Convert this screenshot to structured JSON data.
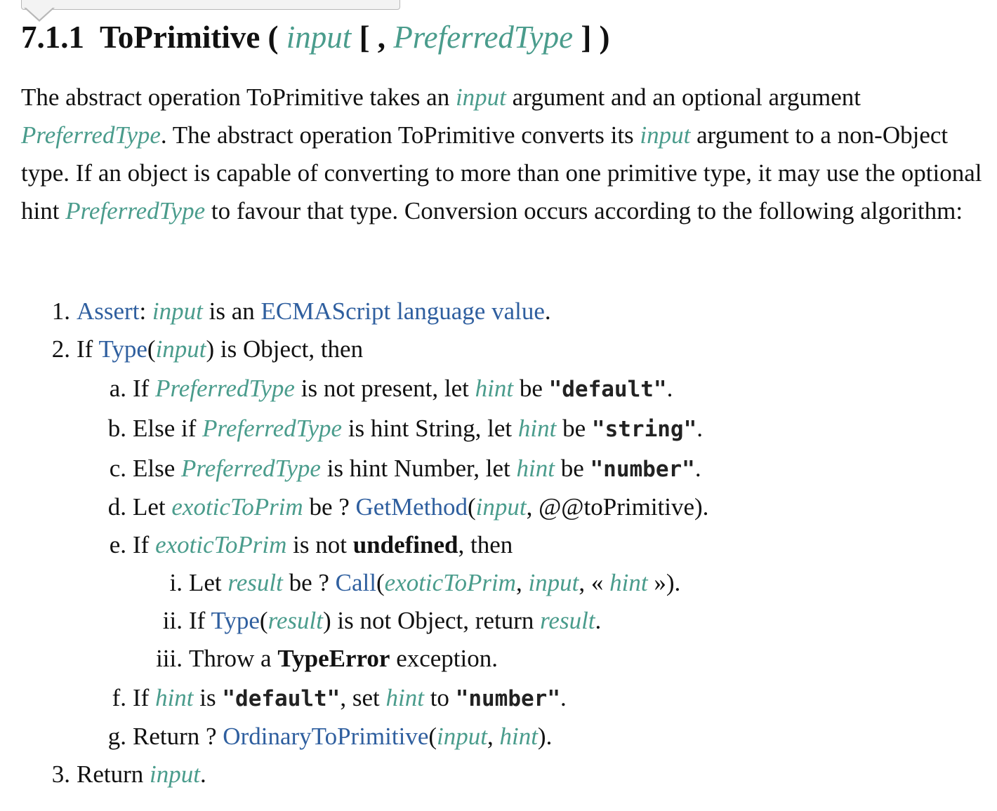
{
  "heading": {
    "secnum": "7.1.1",
    "name": "ToPrimitive",
    "open": "(",
    "param1": "input",
    "bracket_open": "[ ,",
    "param2": "PreferredType",
    "close": "] )"
  },
  "intro": {
    "t1": "The abstract operation ToPrimitive takes an ",
    "v1": "input",
    "t2": " argument and an optional argument ",
    "v2": "PreferredType",
    "t3": ". The abstract operation ToPrimitive converts its ",
    "v3": "input",
    "t4": " argument to a non-Object type. If an object is capable of converting to more than one primitive type, it may use the optional hint ",
    "v4": "PreferredType",
    "t5": " to favour that type. Conversion occurs according to the following algorithm:"
  },
  "steps": {
    "s1": {
      "num": "1.",
      "link1": "Assert",
      "t1": ": ",
      "v1": "input",
      "t2": " is an ",
      "link2": "ECMAScript language value",
      "t3": "."
    },
    "s2": {
      "num": "2.",
      "t1": "If ",
      "link1": "Type",
      "t2": "(",
      "v1": "input",
      "t3": ") is Object, then"
    },
    "sa": {
      "num": "a.",
      "t1": "If ",
      "v1": "PreferredType",
      "t2": " is not present, let ",
      "v2": "hint",
      "t3": " be ",
      "c1": "\"default\"",
      "t4": "."
    },
    "sb": {
      "num": "b.",
      "t1": "Else if ",
      "v1": "PreferredType",
      "t2": " is hint String, let ",
      "v2": "hint",
      "t3": " be ",
      "c1": "\"string\"",
      "t4": "."
    },
    "sc": {
      "num": "c.",
      "t1": "Else ",
      "v1": "PreferredType",
      "t2": " is hint Number, let ",
      "v2": "hint",
      "t3": " be ",
      "c1": "\"number\"",
      "t4": "."
    },
    "sd": {
      "num": "d.",
      "t1": "Let ",
      "v1": "exoticToPrim",
      "t2": " be ? ",
      "link1": "GetMethod",
      "t3": "(",
      "v2": "input",
      "t4": ", @@toPrimitive)."
    },
    "se": {
      "num": "e.",
      "t1": "If ",
      "v1": "exoticToPrim",
      "t2": " is not ",
      "b1": "undefined",
      "t3": ", then"
    },
    "si": {
      "num": "i.",
      "t1": "Let ",
      "v1": "result",
      "t2": " be ? ",
      "link1": "Call",
      "t3": "(",
      "v2": "exoticToPrim",
      "t4": ", ",
      "v3": "input",
      "t5": ", « ",
      "v4": "hint",
      "t6": " »)."
    },
    "sii": {
      "num": "ii.",
      "t1": "If ",
      "link1": "Type",
      "t2": "(",
      "v1": "result",
      "t3": ") is not Object, return ",
      "v2": "result",
      "t4": "."
    },
    "siii": {
      "num": "iii.",
      "t1": "Throw a ",
      "b1": "TypeError",
      "t2": " exception."
    },
    "sf": {
      "num": "f.",
      "t1": "If ",
      "v1": "hint",
      "t2": " is ",
      "c1": "\"default\"",
      "t3": ", set ",
      "v2": "hint",
      "t4": " to ",
      "c2": "\"number\"",
      "t5": "."
    },
    "sg": {
      "num": "g.",
      "t1": "Return ? ",
      "link1": "OrdinaryToPrimitive",
      "t2": "(",
      "v1": "input",
      "t3": ", ",
      "v2": "hint",
      "t4": ")."
    },
    "s3": {
      "num": "3.",
      "t1": "Return ",
      "v1": "input",
      "t2": "."
    }
  },
  "colors": {
    "variable": "#4a9c8c",
    "link": "#2f5f9f",
    "text": "#111111"
  }
}
